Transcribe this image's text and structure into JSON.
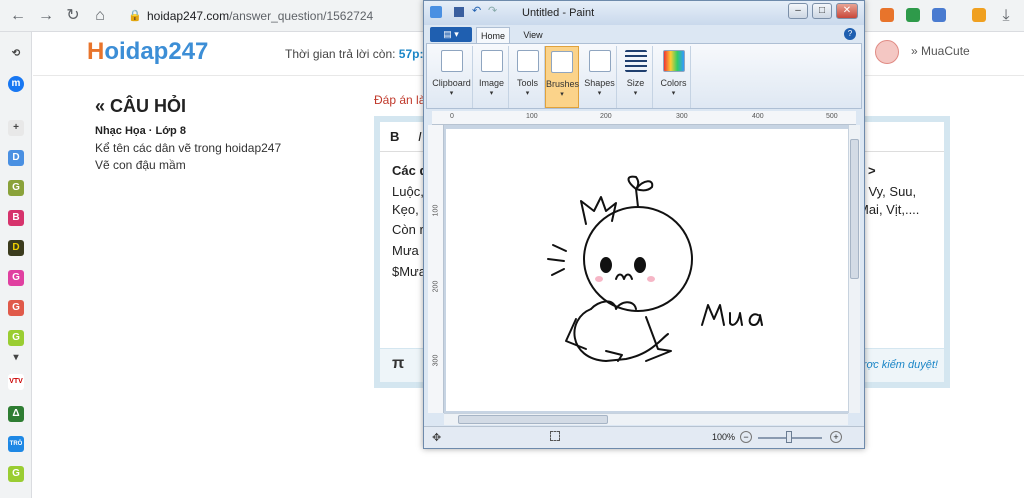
{
  "browser": {
    "url_host": "hoidap247.com",
    "url_path": "/answer_question/1562724",
    "back": "←",
    "forward": "→",
    "reload": "↻",
    "home": "⌂",
    "lock": "🔒"
  },
  "sidebar": {
    "items": [
      "⟲",
      "m",
      "+",
      "D",
      "G",
      "B",
      "D",
      "G",
      "G",
      "G",
      "▾",
      "VTV",
      "Δ",
      "TRÒ",
      "G"
    ]
  },
  "header": {
    "logo_h": "H",
    "logo_rest": "oidap247",
    "timer_label": "Thời gian trả lời còn: ",
    "timer_value": "57p:5",
    "user_name": "MuaCute"
  },
  "question": {
    "title": "« CÂU HỎI",
    "meta": "Nhạc Họa · Lớp 8",
    "body_line1": "Kể tên các dân vẽ trong hoidap247",
    "body_line2": "Vẽ con đậu mầm",
    "answer_label": "Đáp án là"
  },
  "editor": {
    "bold": "B",
    "italic": "I",
    "line1": "Các d",
    "line1_right": ">",
    "line2": "Luộc,",
    "line2_right": "n, Vy, Suu,",
    "line3": "Kẹo, I",
    "line3_right": "Mai, Vịt,....",
    "line4": "Còn r",
    "line5": "Mưa",
    "line6": "$Mưa",
    "pi": "π",
    "moderation": "rợc kiểm duyệt!"
  },
  "paint": {
    "title": "Untitled - Paint",
    "tab_home": "Home",
    "tab_view": "View",
    "groups": [
      "Clipboard",
      "Image",
      "Tools",
      "Brushes",
      "Shapes",
      "Size",
      "Colors"
    ],
    "ruler_h": [
      "0",
      "100",
      "200",
      "300",
      "400",
      "500"
    ],
    "ruler_v": [
      "100",
      "200",
      "300"
    ],
    "zoom": "100%",
    "drawing_text": "Mưa",
    "win_min": "–",
    "win_max": "□",
    "win_close": "✕"
  },
  "colors": {
    "accent": "#1b86c7",
    "answer_red": "#c0392b",
    "paint_active": "#fbd38a"
  }
}
